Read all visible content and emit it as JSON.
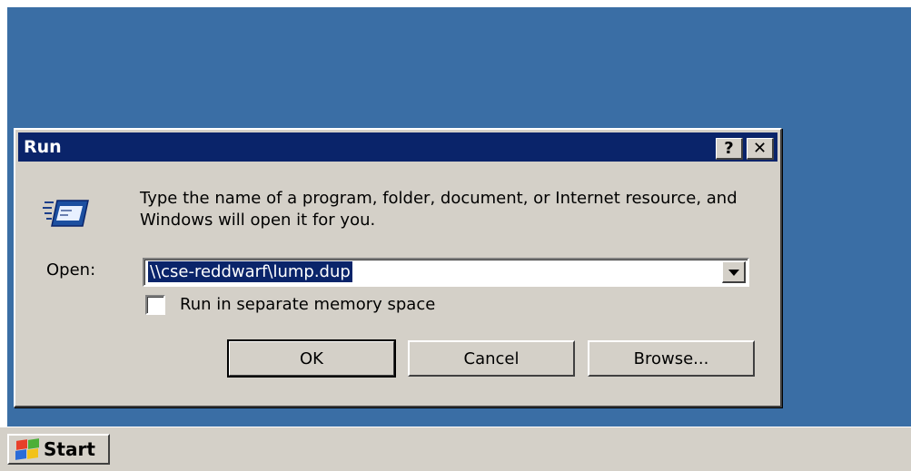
{
  "dialog": {
    "title": "Run",
    "help_glyph": "?",
    "close_glyph": "✕",
    "prompt": "Type the name of a program, folder, document, or Internet resource, and Windows will open it for you.",
    "open_label": "Open:",
    "open_value": "\\\\cse-reddwarf\\lump.dup",
    "checkbox_label": "Run in separate memory space",
    "ok_label": "OK",
    "cancel_label": "Cancel",
    "browse_label": "Browse...",
    "icon": "run-icon"
  },
  "taskbar": {
    "start_label": "Start",
    "start_icon": "windows-flag-icon"
  },
  "colors": {
    "desktop": "#3a6ea5",
    "title_bar": "#0a246a",
    "face": "#d4d0c8",
    "selection": "#0a246a"
  }
}
